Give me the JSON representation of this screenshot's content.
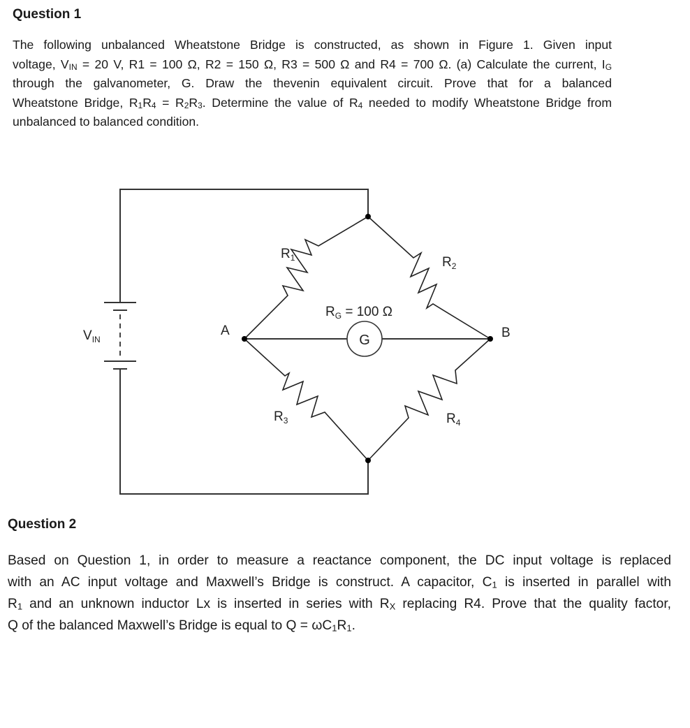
{
  "question1": {
    "title": "Question 1",
    "lines": [
      [
        "The following unbalanced Wheatstone Bridge is constructed, as shown in Figure 1. Given input"
      ],
      [
        "voltage, V",
        {
          "sub": "IN"
        },
        " = 20 V, R1 = 100 Ω, R2 = 150 Ω, R3 = 500 Ω and R4 = 700 Ω. (a) Calculate the current, I",
        {
          "sub": "G"
        }
      ],
      [
        "through the galvanometer, G. Draw the thevenin equivalent circuit.  Prove that for a balanced"
      ],
      [
        "Wheatstone Bridge, R",
        {
          "sub": "1"
        },
        "R",
        {
          "sub": "4"
        },
        " = R",
        {
          "sub": "2"
        },
        "R",
        {
          "sub": "3"
        },
        ". Determine the value of R",
        {
          "sub": "4"
        },
        " needed to modify Wheatstone Bridge from"
      ],
      [
        "unbalanced to balanced condition."
      ]
    ]
  },
  "figure": {
    "source_label": {
      "main": "V",
      "sub": "IN"
    },
    "node_a": "A",
    "node_b": "B",
    "galvanometer_symbol": "G",
    "galvanometer_resistance": {
      "main": "R",
      "sub": "G",
      "rest": " = 100 Ω"
    },
    "resistors": [
      {
        "main": "R",
        "sub": "1"
      },
      {
        "main": "R",
        "sub": "2"
      },
      {
        "main": "R",
        "sub": "3"
      },
      {
        "main": "R",
        "sub": "4"
      }
    ]
  },
  "question2": {
    "title": "Question 2",
    "lines": [
      [
        "Based on Question 1, in order to measure a reactance component, the DC input voltage is replaced"
      ],
      [
        "with an AC input voltage and Maxwell’s Bridge is construct. A capacitor, C",
        {
          "sub": "1"
        },
        " is inserted in parallel with"
      ],
      [
        "R",
        {
          "sub": "1"
        },
        " and an unknown inductor Lx is inserted in series with R",
        {
          "sub": "X"
        },
        " replacing R4. Prove that the quality factor,"
      ],
      [
        "Q of the balanced Maxwell’s Bridge is equal to Q = ωC",
        {
          "sub": "1"
        },
        "R",
        {
          "sub": "1"
        },
        "."
      ]
    ]
  }
}
